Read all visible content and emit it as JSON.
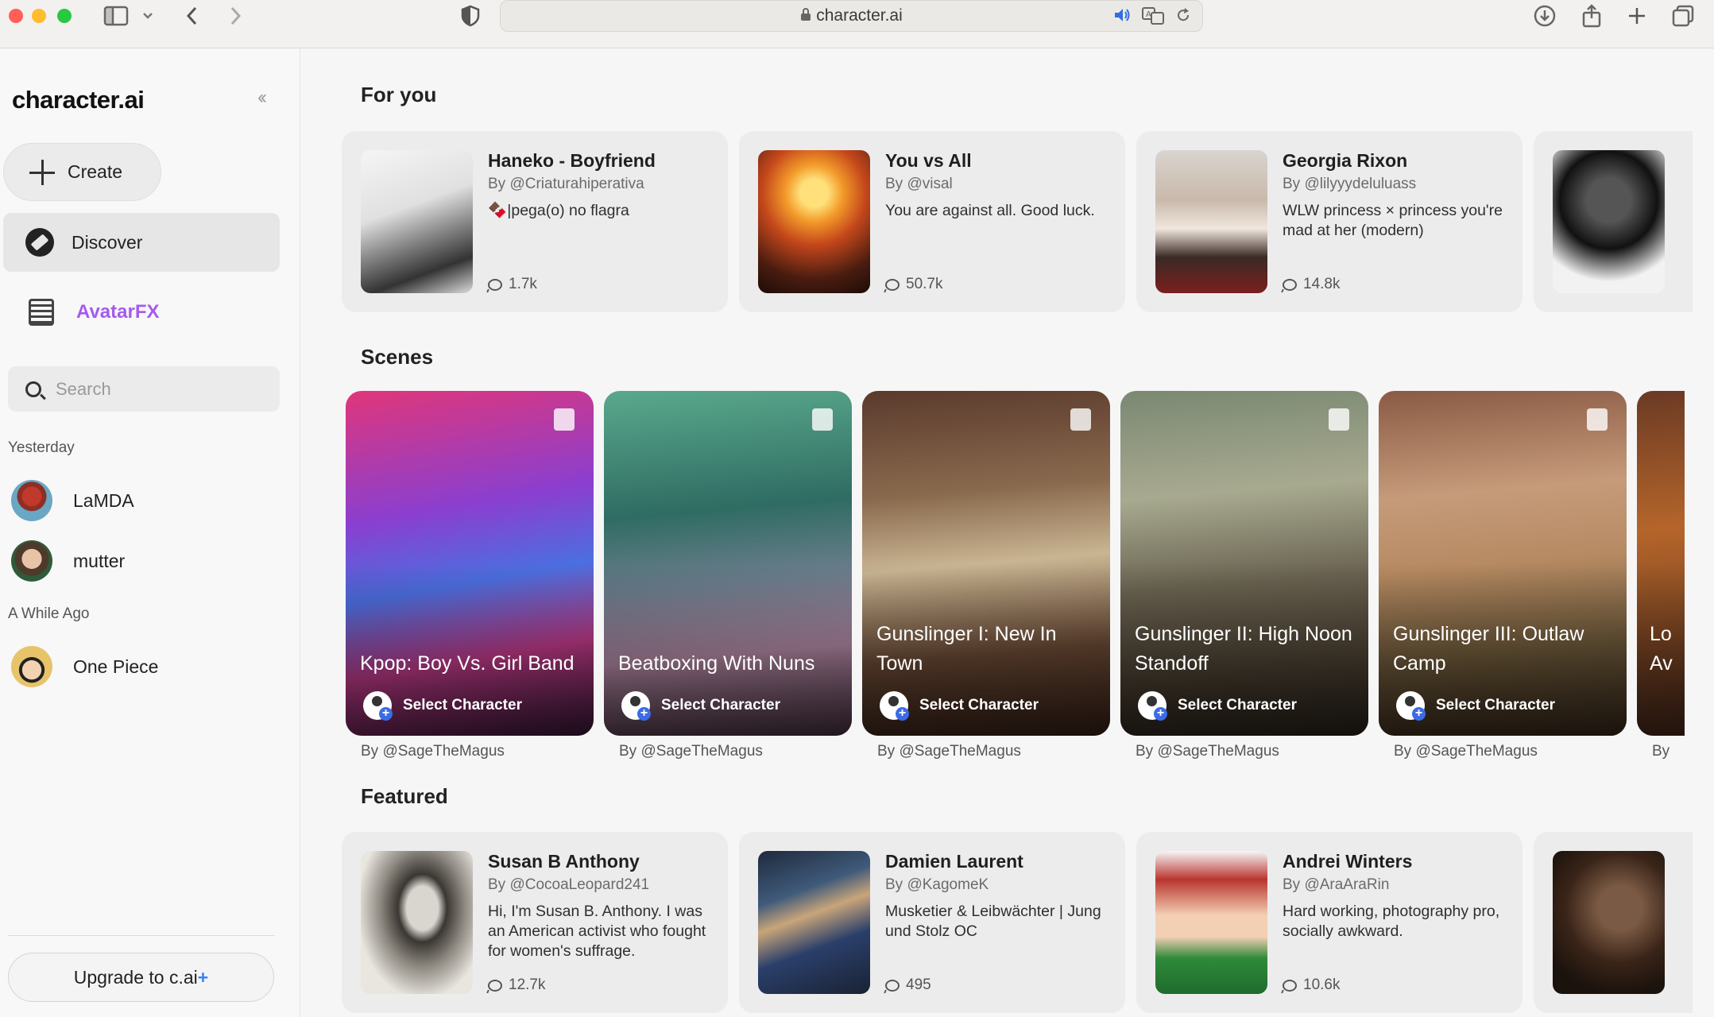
{
  "browser": {
    "url": "character.ai"
  },
  "sidebar": {
    "logo": "character.ai",
    "create_label": "Create",
    "discover_label": "Discover",
    "avatarfx_label": "AvatarFX",
    "search_placeholder": "Search",
    "sections": [
      {
        "label": "Yesterday",
        "items": [
          {
            "name": "LaMDA"
          },
          {
            "name": "mutter"
          }
        ]
      },
      {
        "label": "A While Ago",
        "items": [
          {
            "name": "One Piece"
          }
        ]
      }
    ],
    "upgrade_label": "Upgrade to c.ai",
    "upgrade_plus": "+"
  },
  "main": {
    "for_you": {
      "title": "For you",
      "cards": [
        {
          "title": "Haneko - Boyfriend",
          "by": "By @Criaturahiperativa",
          "desc": "🍫|pega(o) no flagra",
          "count": "1.7k"
        },
        {
          "title": "You vs All",
          "by": "By @visal",
          "desc": "You are against all. Good luck.",
          "count": "50.7k"
        },
        {
          "title": "Georgia Rixon",
          "by": "By @lilyyydeluluass",
          "desc": "WLW princess × princess you're mad at her (modern)",
          "count": "14.8k"
        }
      ]
    },
    "scenes": {
      "title": "Scenes",
      "select_label": "Select Character",
      "items": [
        {
          "title": "Kpop: Boy Vs. Girl Band",
          "by": "By @SageTheMagus"
        },
        {
          "title": "Beatboxing With Nuns",
          "by": "By @SageTheMagus"
        },
        {
          "title": "Gunslinger I: New In Town",
          "by": "By @SageTheMagus"
        },
        {
          "title": "Gunslinger II: High Noon Standoff",
          "by": "By @SageTheMagus"
        },
        {
          "title": "Gunslinger III: Outlaw Camp",
          "by": "By @SageTheMagus"
        },
        {
          "title": "Lo Av",
          "by": "By"
        }
      ]
    },
    "featured": {
      "title": "Featured",
      "cards": [
        {
          "title": "Susan B Anthony",
          "by": "By @CocoaLeopard241",
          "desc": "Hi, I'm Susan B. Anthony. I was an American activist who fought for women's suffrage.",
          "count": "12.7k"
        },
        {
          "title": "Damien Laurent",
          "by": "By @KagomeK",
          "desc": "Musketier & Leibwächter | Jung und Stolz OC",
          "count": "495"
        },
        {
          "title": "Andrei Winters",
          "by": "By @AraAraRin",
          "desc": "Hard working, photography pro, socially awkward.",
          "count": "10.6k"
        }
      ]
    }
  }
}
